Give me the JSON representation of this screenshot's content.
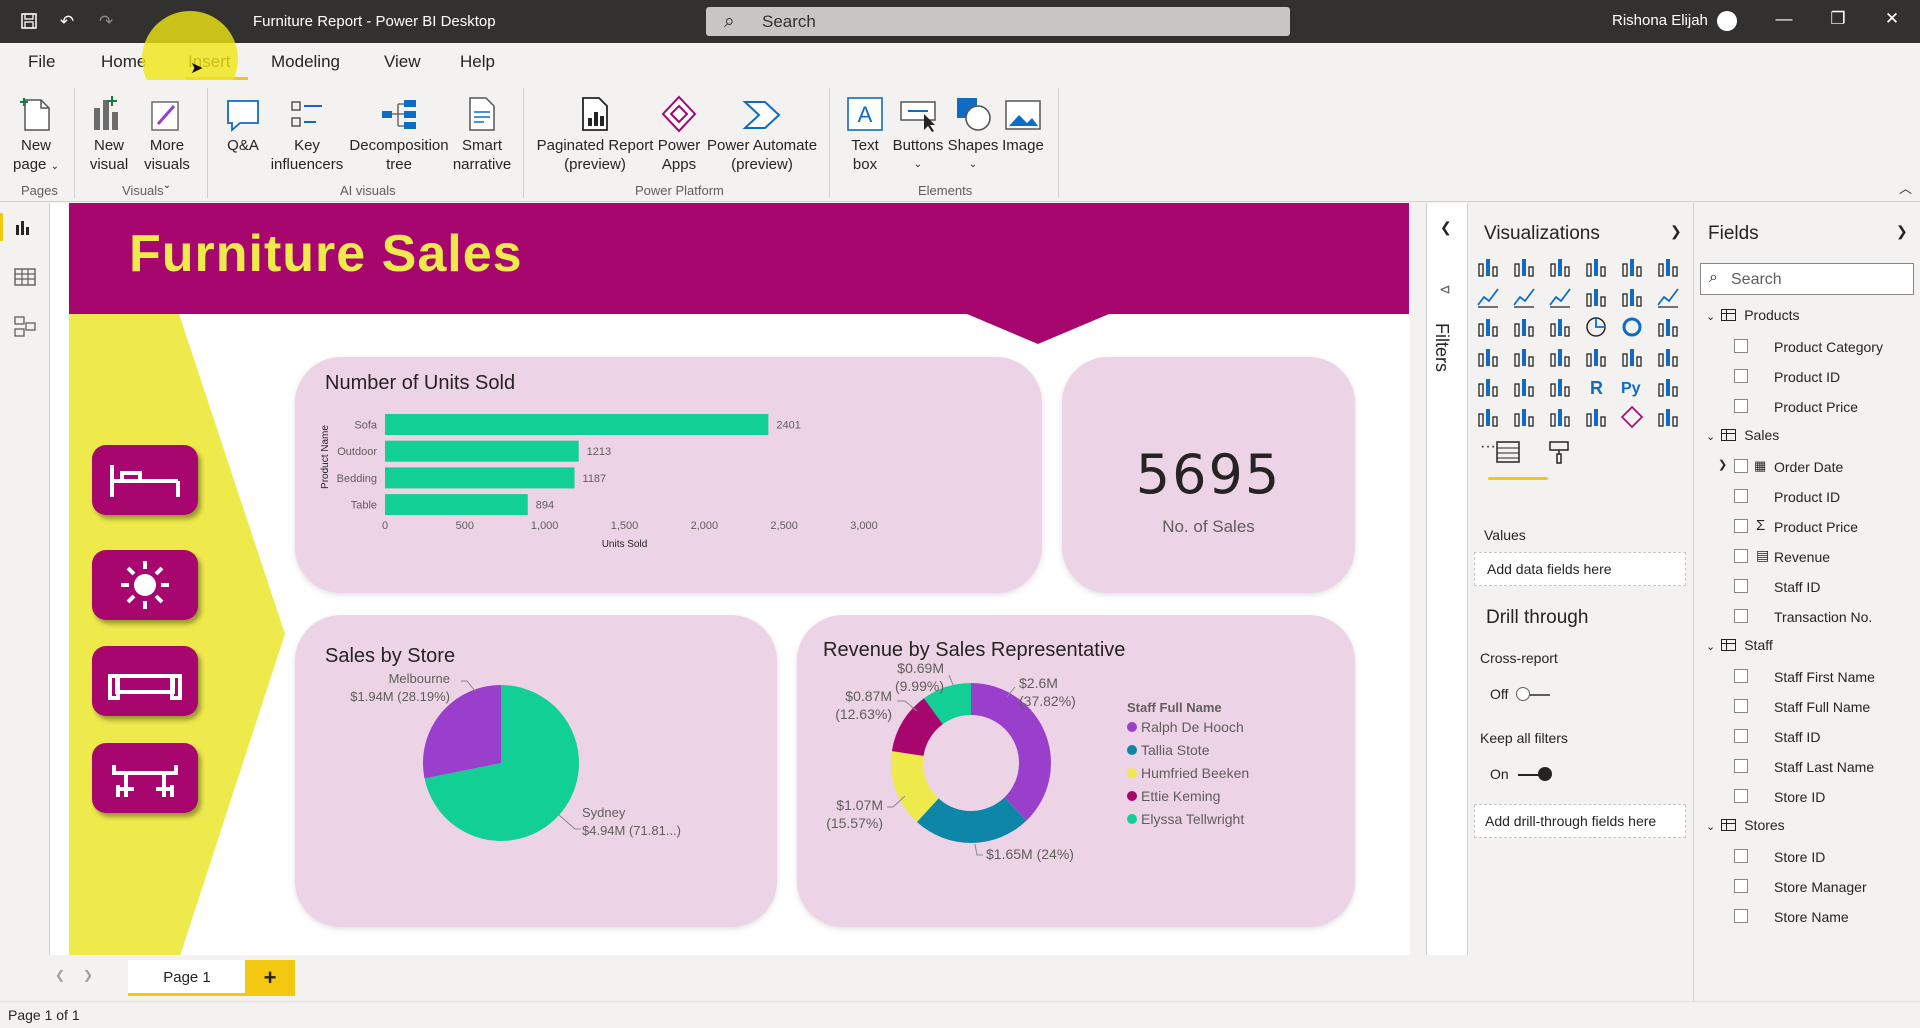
{
  "window": {
    "title": "Furniture Report - Power BI Desktop",
    "search_placeholder": "Search",
    "user_name": "Rishona Elijah"
  },
  "menu": {
    "tabs": [
      "File",
      "Home",
      "Insert",
      "Modeling",
      "View",
      "Help"
    ],
    "active": "Insert"
  },
  "ribbon": {
    "groups": {
      "pages": "Pages",
      "visuals": "Visuals",
      "ai": "AI visuals",
      "platform": "Power Platform",
      "elements": "Elements"
    },
    "new_page": [
      "New",
      "page"
    ],
    "new_visual": [
      "New",
      "visual"
    ],
    "more_visuals": [
      "More",
      "visuals"
    ],
    "qa": "Q&A",
    "key_influencers": [
      "Key",
      "influencers"
    ],
    "decomposition_tree": [
      "Decomposition",
      "tree"
    ],
    "smart_narrative": [
      "Smart",
      "narrative"
    ],
    "paginated_report": [
      "Paginated Report",
      "(preview)"
    ],
    "power_apps": [
      "Power",
      "Apps"
    ],
    "power_automate": [
      "Power Automate",
      "(preview)"
    ],
    "text_box": [
      "Text",
      "box"
    ],
    "buttons": "Buttons",
    "shapes": "Shapes",
    "image": "Image"
  },
  "report": {
    "title": "Furniture Sales",
    "kpi": {
      "value": "5695",
      "label": "No. of Sales"
    },
    "units_title": "Number of Units Sold",
    "store_title": "Sales by Store",
    "rep_title": "Revenue by Sales Representative"
  },
  "chart_data": [
    {
      "type": "bar",
      "orientation": "horizontal",
      "title": "Number of Units Sold",
      "categories": [
        "Sofa",
        "Outdoor",
        "Bedding",
        "Table"
      ],
      "values": [
        2401,
        1213,
        1187,
        894
      ],
      "data_labels": [
        "2401",
        "1213",
        "1187",
        "894"
      ],
      "xlabel": "Units Sold",
      "ylabel": "Product Name",
      "xlim": [
        0,
        3000
      ],
      "xticks": [
        "0",
        "500",
        "1,000",
        "1,500",
        "2,000",
        "2,500",
        "3,000"
      ],
      "color": "#12cf95",
      "grid": false
    },
    {
      "type": "pie",
      "title": "Sales by Store",
      "labels": [
        "Sydney",
        "Melbourne"
      ],
      "values": [
        71.81,
        28.19
      ],
      "data_labels": [
        [
          "Sydney",
          "$4.94M (71.81...)"
        ],
        [
          "Melbourne",
          "$1.94M (28.19%)"
        ]
      ],
      "colors": [
        "#12cf95",
        "#9a3fcc"
      ]
    },
    {
      "type": "pie",
      "style": "donut",
      "title": "Revenue by Sales Representative",
      "legend_title": "Staff Full Name",
      "legend_position": "right",
      "labels": [
        "Ralph De Hooch",
        "Tallia Stote",
        "Humfried Beeken",
        "Ettie Keming",
        "Elyssa Tellwright"
      ],
      "values": [
        37.82,
        24,
        15.57,
        12.63,
        9.99
      ],
      "data_labels": [
        [
          "$2.6M",
          "(37.82%)"
        ],
        [
          "$1.65M (24%)"
        ],
        [
          "$1.07M",
          "(15.57%)"
        ],
        [
          "$0.87M",
          "(12.63%)"
        ],
        [
          "$0.69M",
          "(9.99%)"
        ]
      ],
      "colors": [
        "#9a3fcc",
        "#0e86a8",
        "#eeea4c",
        "#a6066d",
        "#12cf95"
      ]
    }
  ],
  "panes": {
    "filters": "Filters",
    "visualizations": {
      "title": "Visualizations",
      "values_label": "Values",
      "add_fields": "Add data fields here",
      "drill_through": "Drill through",
      "cross_report": "Cross-report",
      "cross_report_state": "Off",
      "keep_filters": "Keep all filters",
      "keep_filters_state": "On",
      "add_drill": "Add drill-through fields here"
    },
    "fields": {
      "title": "Fields",
      "search_placeholder": "Search",
      "tables": [
        {
          "name": "Products",
          "fields": [
            "Product Category",
            "Product ID",
            "Product Price"
          ]
        },
        {
          "name": "Sales",
          "fields": [
            "Order Date",
            "Product ID",
            "Product Price",
            "Revenue",
            "Staff ID",
            "Transaction No."
          ]
        },
        {
          "name": "Staff",
          "fields": [
            "Staff First Name",
            "Staff Full Name",
            "Staff ID",
            "Staff Last Name",
            "Store ID"
          ]
        },
        {
          "name": "Stores",
          "fields": [
            "Store ID",
            "Store Manager",
            "Store Name"
          ]
        }
      ]
    }
  },
  "pages": {
    "tabs": [
      "Page 1"
    ],
    "add": "+"
  },
  "status": {
    "text": "Page 1 of 1"
  }
}
